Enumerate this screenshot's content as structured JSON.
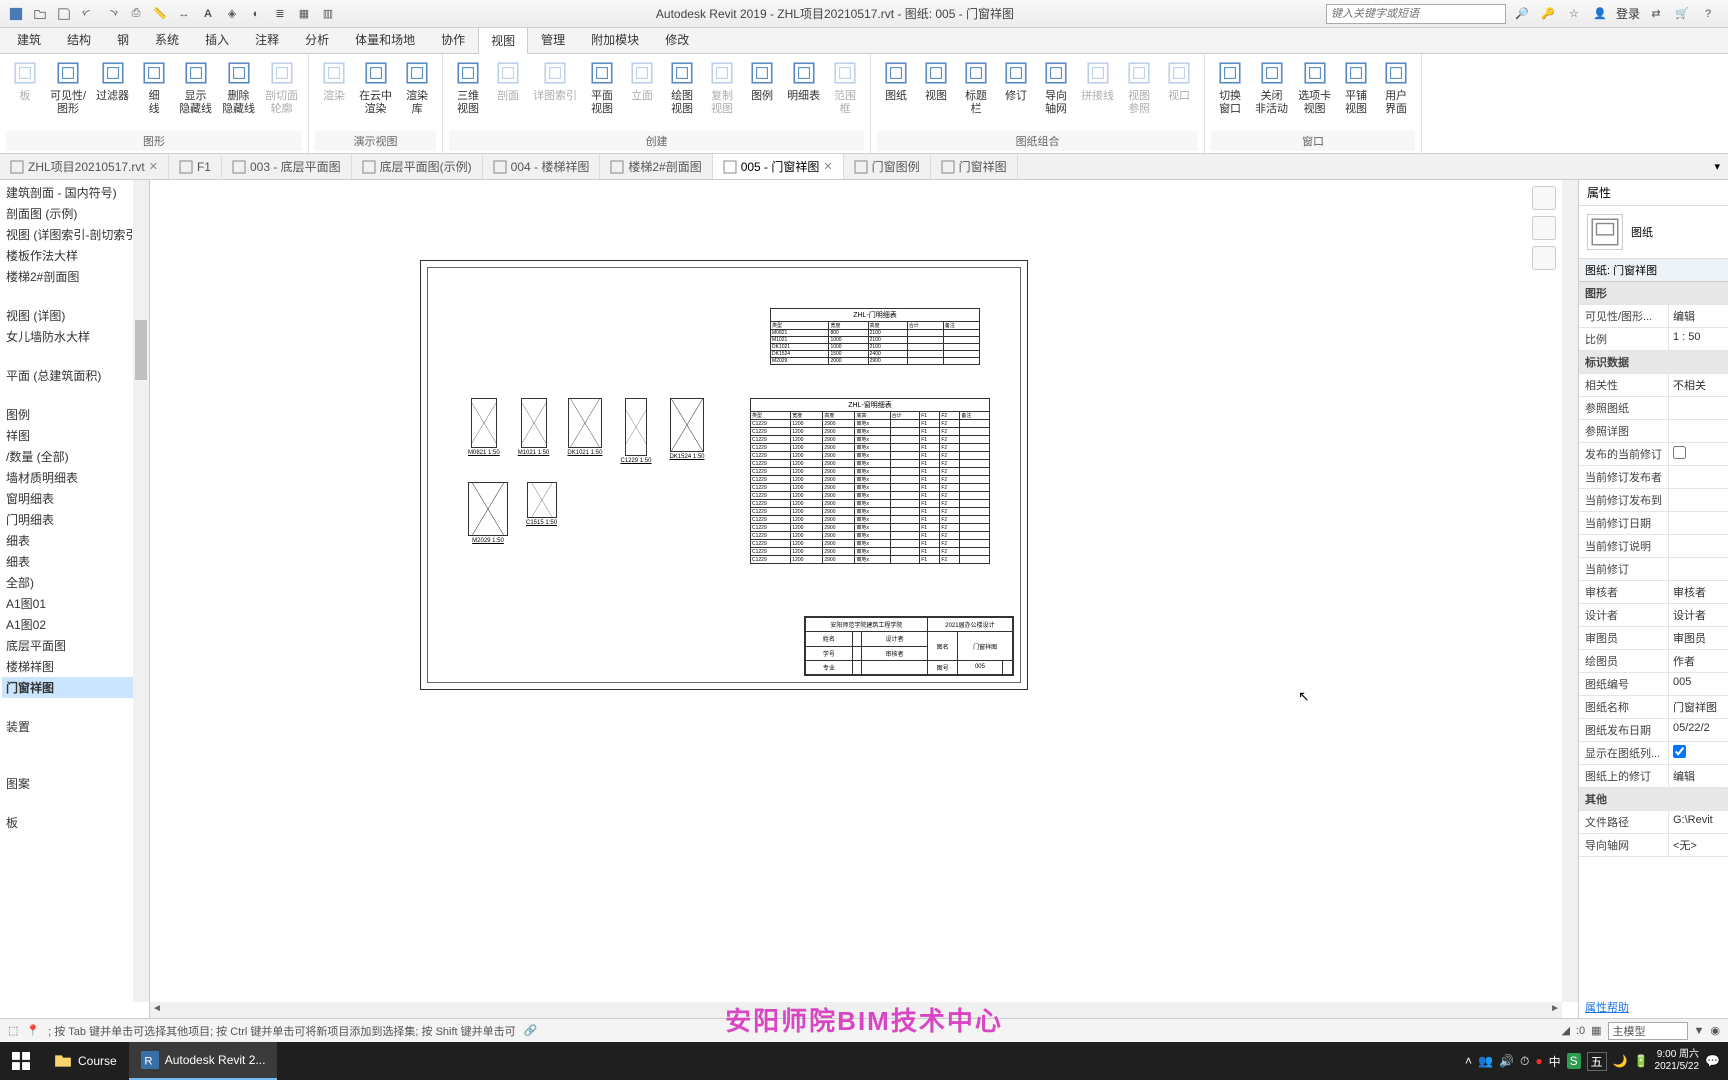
{
  "title": "Autodesk Revit 2019 - ZHL项目20210517.rvt - 图纸: 005 - 门窗祥图",
  "search_placeholder": "键入关键字或短语",
  "login": "登录",
  "ribbon_tabs": [
    "建筑",
    "结构",
    "钢",
    "系统",
    "插入",
    "注释",
    "分析",
    "体量和场地",
    "协作",
    "视图",
    "管理",
    "附加模块",
    "修改"
  ],
  "active_ribbon_tab": 9,
  "ribbon_groups": [
    {
      "label": "图形",
      "buttons": [
        {
          "label": "板",
          "dis": true
        },
        {
          "label": "可见性/\n图形"
        },
        {
          "label": "过滤器"
        },
        {
          "label": "细\n线"
        },
        {
          "label": "显示\n隐藏线"
        },
        {
          "label": "删除\n隐藏线"
        },
        {
          "label": "剖切面\n轮廓",
          "dis": true
        }
      ]
    },
    {
      "label": "演示视图",
      "buttons": [
        {
          "label": "渲染",
          "dis": true
        },
        {
          "label": "在云中\n渲染"
        },
        {
          "label": "渲染\n库"
        }
      ]
    },
    {
      "label": "创建",
      "buttons": [
        {
          "label": "三维\n视图"
        },
        {
          "label": "剖面",
          "dis": true
        },
        {
          "label": "详图索引",
          "dis": true
        },
        {
          "label": "平面\n视图"
        },
        {
          "label": "立面",
          "dis": true
        },
        {
          "label": "绘图\n视图"
        },
        {
          "label": "复制\n视图",
          "dis": true
        },
        {
          "label": "图例"
        },
        {
          "label": "明细表"
        },
        {
          "label": "范围\n框",
          "dis": true
        }
      ]
    },
    {
      "label": "图纸组合",
      "buttons": [
        {
          "label": "图纸"
        },
        {
          "label": "视图"
        },
        {
          "label": "标题\n栏"
        },
        {
          "label": "修订"
        },
        {
          "label": "导向\n轴网"
        },
        {
          "label": "拼接线",
          "dis": true
        },
        {
          "label": "视图\n参照",
          "dis": true
        },
        {
          "label": "视口",
          "dis": true
        }
      ]
    },
    {
      "label": "窗口",
      "buttons": [
        {
          "label": "切换\n窗口"
        },
        {
          "label": "关闭\n非活动"
        },
        {
          "label": "选项卡\n视图"
        },
        {
          "label": "平铺\n视图"
        },
        {
          "label": "用户\n界面"
        }
      ]
    }
  ],
  "doc_tabs": [
    {
      "label": "ZHL项目20210517.rvt",
      "close": true
    },
    {
      "label": "F1"
    },
    {
      "label": "003 - 底层平面图"
    },
    {
      "label": "底层平面图(示例)"
    },
    {
      "label": "004 - 楼梯祥图"
    },
    {
      "label": "楼梯2#剖面图"
    },
    {
      "label": "005 - 门窗祥图",
      "active": true,
      "close": true
    },
    {
      "label": "门窗图例"
    },
    {
      "label": "门窗祥图"
    }
  ],
  "browser_items": [
    "建筑剖面 - 国内符号)",
    "剖面图 (示例)",
    "视图 (详图索引-剖切索引",
    "楼板作法大样",
    "楼梯2#剖面图",
    "",
    "视图 (详图)",
    "女儿墙防水大样",
    "",
    "平面 (总建筑面积)",
    "",
    "图例",
    "祥图",
    "/数量 (全部)",
    "墙材质明细表",
    "窗明细表",
    "门明细表",
    "细表",
    "细表",
    "全部)",
    "  A1图01",
    "  A1图02",
    "  底层平面图",
    "  楼梯祥图",
    "  门窗祥图",
    "",
    "装置",
    "",
    "",
    "图案",
    "",
    "板"
  ],
  "browser_selected": 24,
  "schedule1_title": "ZHL-门明细表",
  "schedule2_title": "ZHL-窗明细表",
  "door_labels": [
    "M0821",
    "M1021",
    "DK1021",
    "C1229",
    "DK1524",
    "M2029",
    "C1515"
  ],
  "titleblock": {
    "school": "安阳师范学院建筑工程学院",
    "project": "2021届办公楼设计",
    "drawing": "门窗祥图",
    "num_label": "图号",
    "num": "005"
  },
  "props": {
    "header": "属性",
    "type": "图纸",
    "selector": "图纸: 门窗祥图",
    "groups": [
      {
        "name": "图形",
        "rows": [
          [
            "可见性/图形...",
            "编辑"
          ],
          [
            "比例",
            "1 : 50"
          ]
        ]
      },
      {
        "name": "标识数据",
        "rows": [
          [
            "相关性",
            "不相关"
          ],
          [
            "参照图纸",
            ""
          ],
          [
            "参照详图",
            ""
          ],
          [
            "发布的当前修订",
            "☐"
          ],
          [
            "当前修订发布者",
            ""
          ],
          [
            "当前修订发布到",
            ""
          ],
          [
            "当前修订日期",
            ""
          ],
          [
            "当前修订说明",
            ""
          ],
          [
            "当前修订",
            ""
          ],
          [
            "审核者",
            "审核者"
          ],
          [
            "设计者",
            "设计者"
          ],
          [
            "审图员",
            "审图员"
          ],
          [
            "绘图员",
            "作者"
          ],
          [
            "图纸编号",
            "005"
          ],
          [
            "图纸名称",
            "门窗祥图"
          ],
          [
            "图纸发布日期",
            "05/22/2"
          ],
          [
            "显示在图纸列...",
            "☑"
          ],
          [
            "图纸上的修订",
            "编辑"
          ]
        ]
      },
      {
        "name": "其他",
        "rows": [
          [
            "文件路径",
            "G:\\Revit"
          ],
          [
            "导向轴网",
            "<无>"
          ]
        ]
      }
    ],
    "help": "属性帮助"
  },
  "status_hint": "; 按 Tab 键并单击可选择其他项目; 按 Ctrl 键并单击可将新项目添加到选择集; 按 Shift 键并单击可",
  "status_scale": ":0",
  "status_model": "主模型",
  "watermark": "安阳师院BIM技术中心",
  "taskbar": {
    "course": "Course",
    "revit": "Autodesk Revit 2...",
    "ime": "五",
    "time": "9:00 周六",
    "date": "2021/5/22"
  }
}
